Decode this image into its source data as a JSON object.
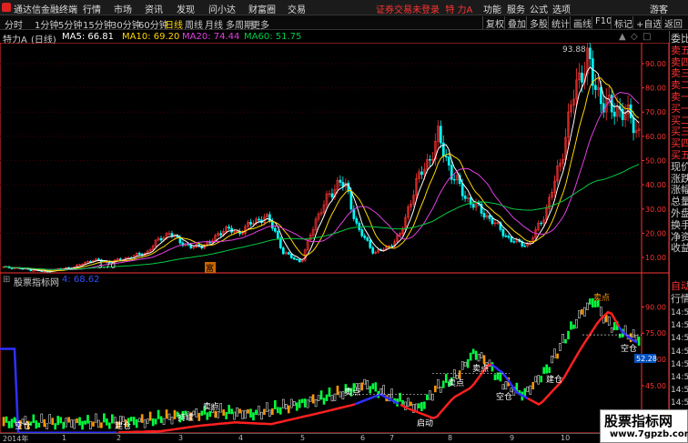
{
  "titlebar": {
    "app_title": "通达信金融终端",
    "menus": [
      "行情",
      "市场",
      "资讯",
      "发现",
      "问小达",
      "财富圈",
      "交易"
    ],
    "warning": "证券交易未登录",
    "stock_name_top": "特 力A",
    "right_items": [
      "功能",
      "服务",
      "公式",
      "选项",
      "游客"
    ]
  },
  "periodbar": {
    "periods": [
      "分时",
      "1分钟",
      "5分钟",
      "15分钟",
      "30分钟",
      "60分钟",
      "日线",
      "周线",
      "月线",
      "多周期",
      "更多"
    ],
    "active": "日线",
    "right_buttons": [
      "复权",
      "叠加",
      "多股",
      "统计",
      "画线",
      "F10",
      "标记",
      "+自选",
      "返回"
    ]
  },
  "infoline": {
    "stock": "特力A",
    "period": "(日线)",
    "ma5": "MA5: 66.81",
    "ma10": "MA10: 69.20",
    "ma20": "MA20: 74.44",
    "ma60": "MA60: 51.75"
  },
  "colors": {
    "ma5": "#ffffff",
    "ma10": "#ffd700",
    "ma20": "#e040e0",
    "ma60": "#00cc44",
    "up": "#ff3333",
    "down": "#00ffff",
    "axis": "#ff3333",
    "sub_red": "#ff2020",
    "sub_blue": "#3030ff",
    "sub_green": "#00ff40",
    "sub_orange": "#ff9900"
  },
  "main_axis": {
    "ticks": [
      "90.00",
      "80.00",
      "70.00",
      "60.00",
      "50.00",
      "40.00",
      "30.00",
      "20.00",
      "10.00"
    ],
    "high_label": "93.88",
    "low_label": "3.70",
    "marker_label": "富"
  },
  "subinfo": {
    "name": "股票指标网",
    "value": "4: 68.62"
  },
  "sub_axis": {
    "ticks": [
      "90.00",
      "75.00",
      "60.00",
      "45.00",
      "30.00"
    ],
    "current_value": "52.28"
  },
  "sub_annotations": {
    "sell_points": [
      "卖点",
      "卖点",
      "卖点",
      "卖点",
      "卖点"
    ],
    "empty_positions": [
      "空仓",
      "空仓",
      "空仓"
    ],
    "buy_label": "建仓",
    "launch_label": "启动",
    "hold_label": "持续"
  },
  "quotepanel": {
    "items": [
      "委比",
      "卖五",
      "卖四",
      "卖三",
      "卖二",
      "卖一",
      "买一",
      "买二",
      "买三",
      "买四",
      "买五",
      "现价",
      "涨跌",
      "涨幅",
      "总量",
      "外盘",
      "换手",
      "净资",
      "收益"
    ],
    "lower": [
      "自动",
      "行情"
    ],
    "times": [
      "14:50",
      "14:50",
      "14:50",
      "14:50",
      "14:50",
      "14:50",
      "14:50",
      "14:50",
      "14:50",
      "14:50"
    ],
    "top_mark": "L"
  },
  "xaxis": {
    "labels": [
      "2014年",
      "1",
      "2",
      "3",
      "4",
      "5",
      "6",
      "7",
      "8",
      "9",
      "10",
      "11"
    ]
  },
  "watermark": {
    "line1": "股票指标网",
    "line2": "www.7gpzb.com"
  }
}
